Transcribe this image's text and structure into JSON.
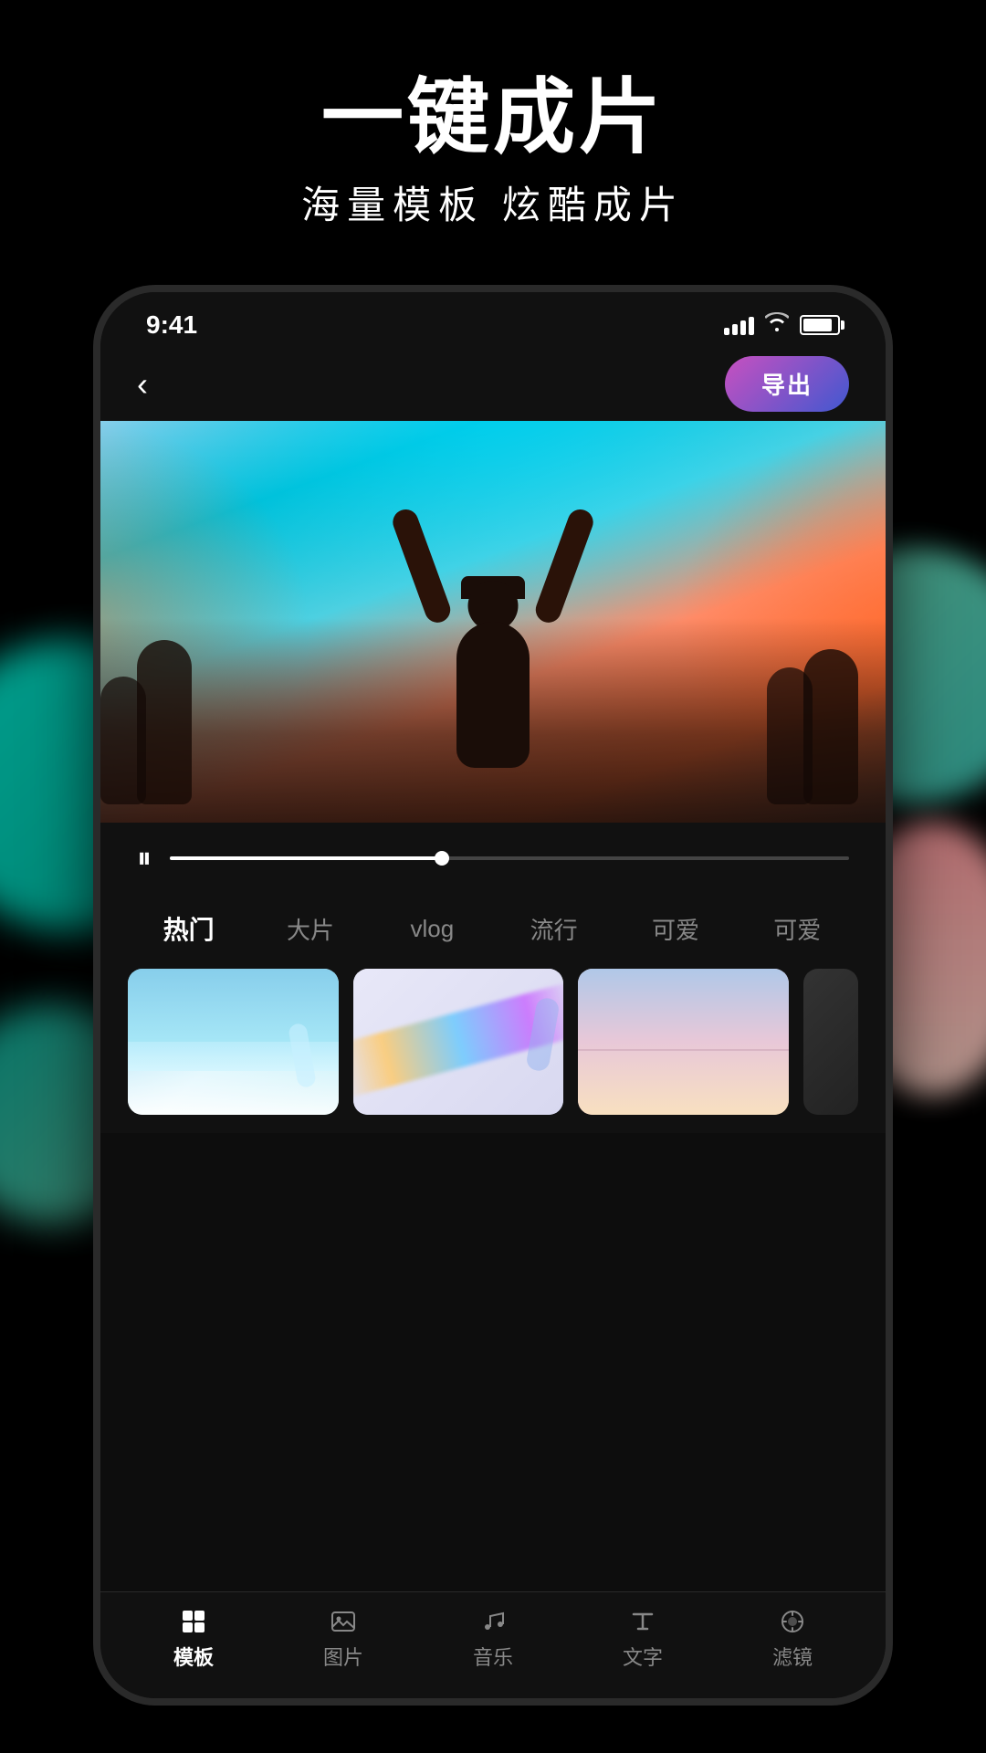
{
  "header": {
    "title": "一键成片",
    "subtitle": "海量模板   炫酷成片"
  },
  "statusBar": {
    "time": "9:41",
    "signal": "signal",
    "wifi": "wifi",
    "battery": "battery"
  },
  "navBar": {
    "backLabel": "‹",
    "exportLabel": "导出"
  },
  "progressBar": {
    "playIcon": "⏸",
    "fillPercent": 40
  },
  "categoryTabs": [
    {
      "label": "热门",
      "active": true
    },
    {
      "label": "大片",
      "active": false
    },
    {
      "label": "vlog",
      "active": false
    },
    {
      "label": "流行",
      "active": false
    },
    {
      "label": "可爱",
      "active": false
    },
    {
      "label": "可爱",
      "active": false
    }
  ],
  "bottomNav": [
    {
      "label": "模板",
      "active": true,
      "icon": "template-icon"
    },
    {
      "label": "图片",
      "active": false,
      "icon": "image-icon"
    },
    {
      "label": "音乐",
      "active": false,
      "icon": "music-icon"
    },
    {
      "label": "文字",
      "active": false,
      "icon": "text-icon"
    },
    {
      "label": "滤镜",
      "active": false,
      "icon": "filter-icon"
    }
  ]
}
